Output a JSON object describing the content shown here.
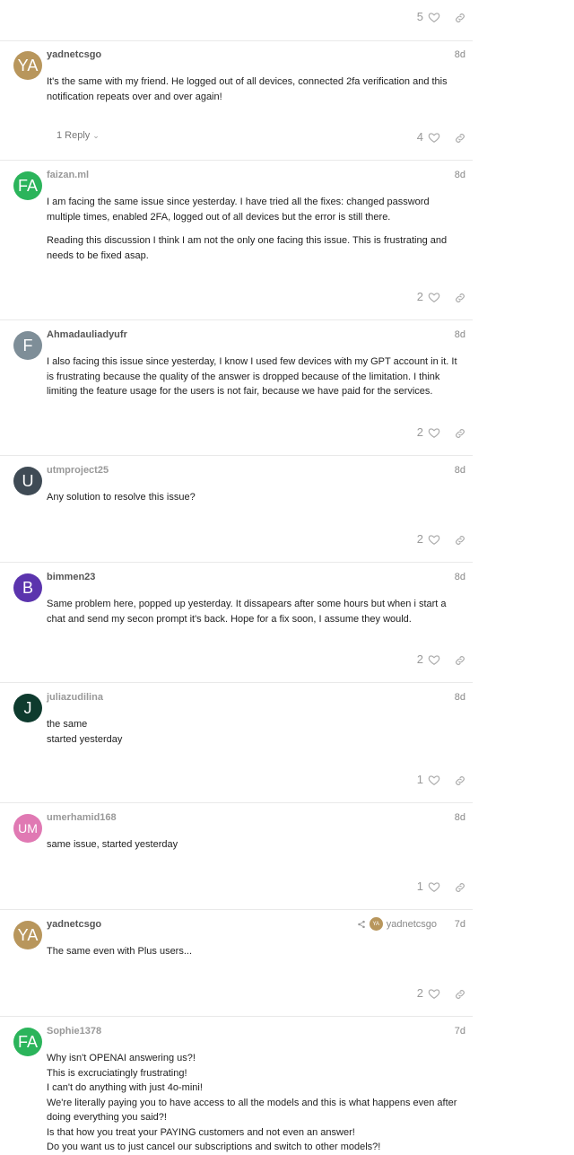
{
  "top": {
    "likes": "5"
  },
  "posts": [
    {
      "username": "yadnetcsgo",
      "avatar": "YA",
      "avatar_color": "#b8965c",
      "date": "8d",
      "lines": [
        "It's the same with my friend. He logged out of all devices, connected 2fa verification and this notification repeats over and over again!"
      ],
      "reply_label": "1 Reply",
      "likes": "4"
    },
    {
      "username": "faizan.ml",
      "avatar": "FA",
      "avatar_color": "#2bb45b",
      "date": "8d",
      "paragraphs": [
        "I am facing the same issue since yesterday. I have tried all the fixes: changed password multiple times, enabled 2FA, logged out of all devices but the error is still there.",
        "Reading this discussion I think I am not the only one facing this issue. This is frustrating and needs to be fixed asap."
      ],
      "likes": "2"
    },
    {
      "username": "Ahmadauliadyufr",
      "avatar": "F",
      "avatar_color": "#7e8e98",
      "date": "8d",
      "lines": [
        "I also facing this issue since yesterday, I know I used few devices with my GPT account in it. It is frustrating because the quality of the answer is dropped because of the limitation. I think limiting the feature usage for the users is not fair, because we have paid for the services."
      ],
      "likes": "2"
    },
    {
      "username": "utmproject25",
      "avatar": "U",
      "avatar_color": "#3f4b55",
      "date": "8d",
      "lines": [
        "Any solution to resolve this issue?"
      ],
      "likes": "2"
    },
    {
      "username": "bimmen23",
      "avatar": "B",
      "avatar_color": "#5b34ad",
      "date": "8d",
      "lines": [
        "Same problem here, popped up yesterday. It dissapears after some hours but when i start a chat and send my secon prompt it's back. Hope for a fix soon, I assume they would."
      ],
      "likes": "2"
    },
    {
      "username": "juliazudilina",
      "avatar": "J",
      "avatar_color": "#0e3b2e",
      "date": "8d",
      "lines": [
        "the same",
        "started yesterday"
      ],
      "likes": "1"
    },
    {
      "username": "umerhamid168",
      "avatar": "UM",
      "avatar_color": "#e079b3",
      "date": "8d",
      "lines": [
        "same issue, started yesterday"
      ],
      "likes": "1"
    },
    {
      "username": "yadnetcsgo",
      "avatar": "YA",
      "avatar_color": "#b8965c",
      "date": "7d",
      "reply_to": {
        "avatar": "YA",
        "username": "yadnetcsgo"
      },
      "lines": [
        "The same even with Plus users..."
      ],
      "likes": "2"
    },
    {
      "username": "Sophie1378",
      "avatar": "FA",
      "avatar_color": "#2bb45b",
      "date": "7d",
      "lines": [
        "Why isn't OPENAI answering us?!",
        "This is excruciatingly frustrating!",
        "I can't do anything with just 4o-mini!",
        "We're literally paying you to have access to all the models and this is what happens even after doing everything you said?!",
        "Is that how you treat your PAYING customers and not even an answer!",
        "Do you want us to just cancel our subscriptions and switch to other models?!"
      ]
    }
  ]
}
